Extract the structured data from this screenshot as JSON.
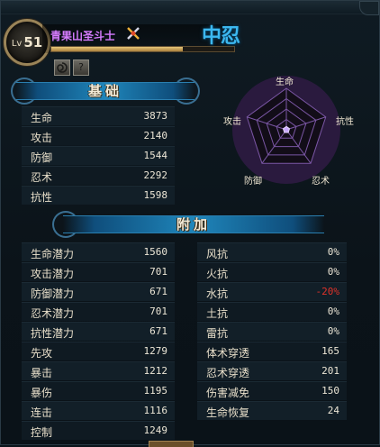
{
  "header": {
    "level_label": "Lv",
    "level": "51",
    "name": "青果山圣斗士",
    "rank": "中忍",
    "exp_fraction": 0.72
  },
  "icons": [
    "swirl-icon",
    "help-scroll-icon",
    "crossed-swords-icon"
  ],
  "basic": {
    "title": "基础",
    "rows": [
      {
        "label": "生命",
        "value": "3873"
      },
      {
        "label": "攻击",
        "value": "2140"
      },
      {
        "label": "防御",
        "value": "1544"
      },
      {
        "label": "忍术",
        "value": "2292"
      },
      {
        "label": "抗性",
        "value": "1598"
      }
    ]
  },
  "radar": {
    "axes": [
      "生命",
      "抗性",
      "忍术",
      "防御",
      "攻击"
    ],
    "values": [
      0.08,
      0.08,
      0.08,
      0.08,
      0.08
    ],
    "levels": 4
  },
  "extra": {
    "title": "附加",
    "left": [
      {
        "label": "生命潜力",
        "value": "1560"
      },
      {
        "label": "攻击潜力",
        "value": "701"
      },
      {
        "label": "防御潜力",
        "value": "671"
      },
      {
        "label": "忍术潜力",
        "value": "701"
      },
      {
        "label": "抗性潜力",
        "value": "671"
      },
      {
        "label": "先攻",
        "value": "1279"
      },
      {
        "label": "暴击",
        "value": "1212"
      },
      {
        "label": "暴伤",
        "value": "1195"
      },
      {
        "label": "连击",
        "value": "1116"
      },
      {
        "label": "控制",
        "value": "1249"
      }
    ],
    "right": [
      {
        "label": "风抗",
        "value": "0%"
      },
      {
        "label": "火抗",
        "value": "0%"
      },
      {
        "label": "水抗",
        "value": "-20%",
        "negative": true
      },
      {
        "label": "土抗",
        "value": "0%"
      },
      {
        "label": "雷抗",
        "value": "0%"
      },
      {
        "label": "体术穿透",
        "value": "165"
      },
      {
        "label": "忍术穿透",
        "value": "201"
      },
      {
        "label": "伤害减免",
        "value": "150"
      },
      {
        "label": "生命恢复",
        "value": "24"
      }
    ]
  },
  "colors": {
    "name": "#d67cff",
    "rank": "#3cb8f0",
    "negative": "#e0322a"
  }
}
